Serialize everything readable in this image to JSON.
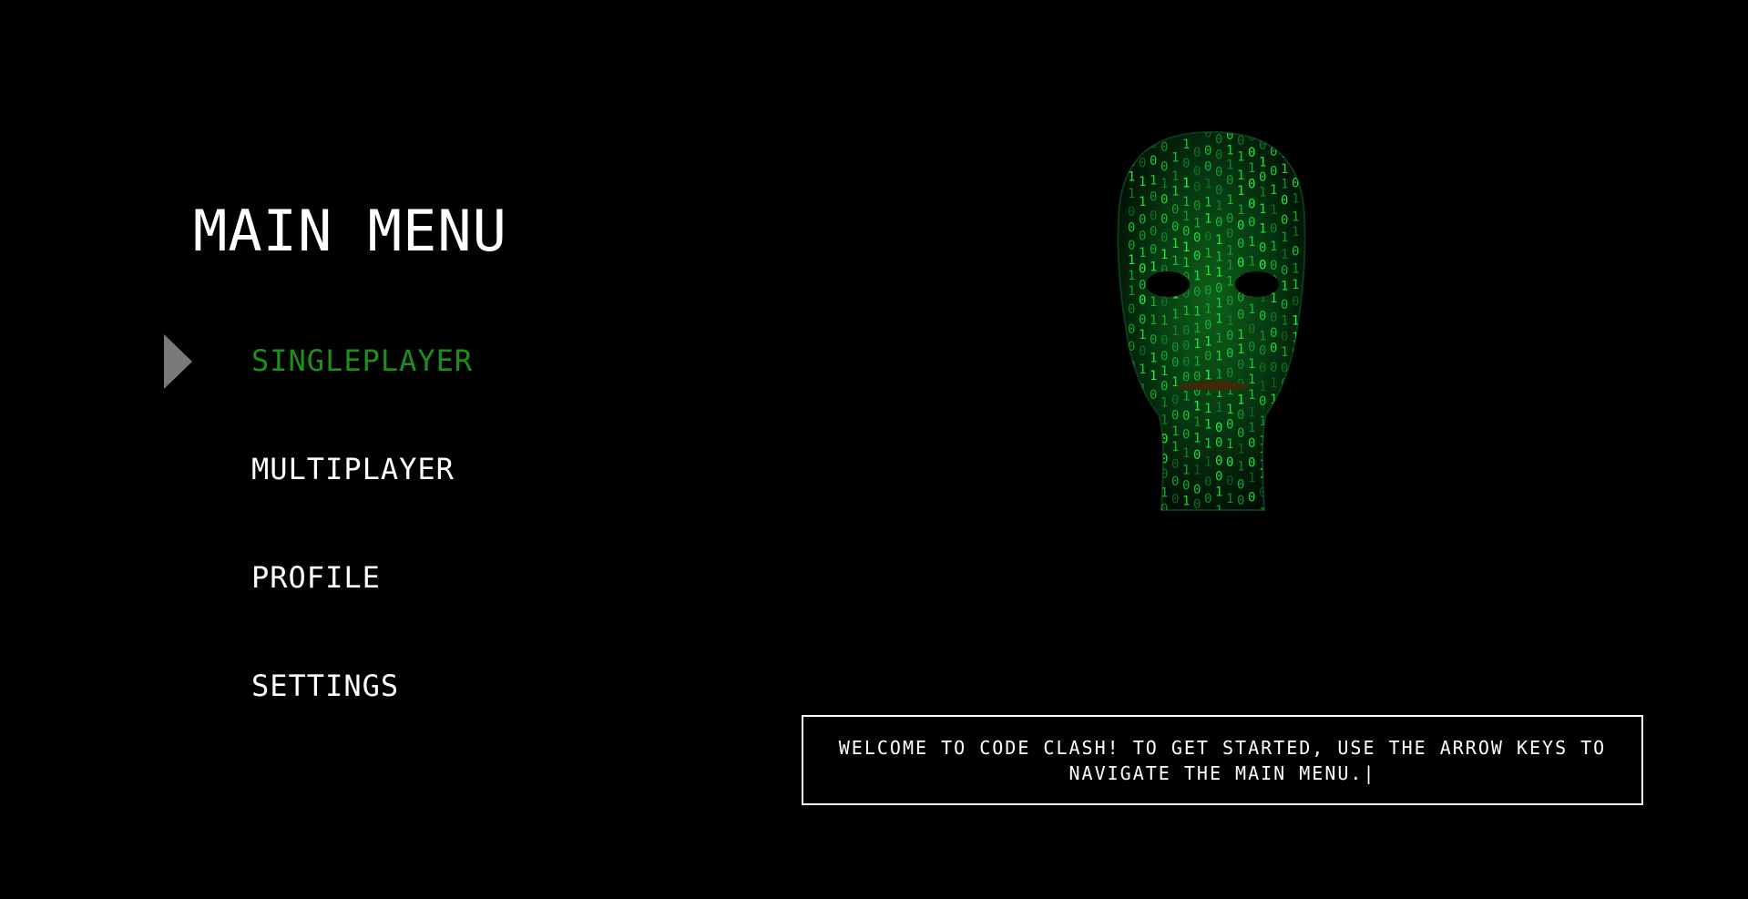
{
  "menu": {
    "title": "MAIN MENU",
    "selected_index": 0,
    "items": [
      {
        "label": "SINGLEPLAYER",
        "selected": true
      },
      {
        "label": "MULTIPLAYER",
        "selected": false
      },
      {
        "label": "PROFILE",
        "selected": false
      },
      {
        "label": "SETTINGS",
        "selected": false
      }
    ]
  },
  "colors": {
    "background": "#000000",
    "text": "#ffffff",
    "selected": "#1d8f1d",
    "selector_arrow": "#7a7a7a",
    "matrix_green": "#22ff44"
  },
  "icons": {
    "selector": "triangle-right-icon",
    "hero": "matrix-code-head-icon"
  },
  "message": {
    "text": "WELCOME TO CODE CLASH! TO GET STARTED, USE THE ARROW KEYS TO NAVIGATE THE MAIN MENU.|"
  }
}
